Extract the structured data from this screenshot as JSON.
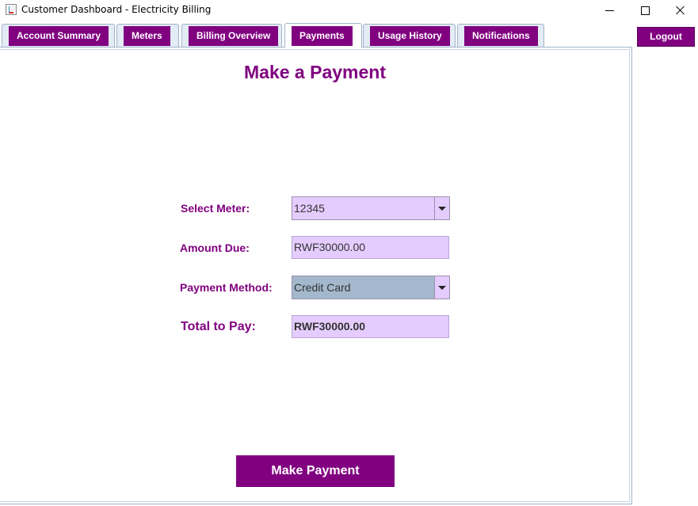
{
  "window": {
    "title": "Customer Dashboard - Electricity Billing"
  },
  "tabs": [
    {
      "label": "Account Summary",
      "selected": false
    },
    {
      "label": "Meters",
      "selected": false
    },
    {
      "label": "Billing Overview",
      "selected": false
    },
    {
      "label": "Payments",
      "selected": true
    },
    {
      "label": "Usage History",
      "selected": false
    },
    {
      "label": "Notifications",
      "selected": false
    }
  ],
  "logout_label": "Logout",
  "payment_form": {
    "heading": "Make a Payment",
    "select_meter_label": "Select Meter:",
    "select_meter_value": "12345",
    "amount_due_label": "Amount Due:",
    "amount_due_value": "RWF30000.00",
    "payment_method_label": "Payment Method:",
    "payment_method_value": "Credit Card",
    "total_label": "Total to Pay:",
    "total_value": "RWF30000.00",
    "submit_label": "Make Payment"
  },
  "colors": {
    "accent": "#800080",
    "field_background": "#e5ccff",
    "selected_option_background": "#a3b8cc"
  }
}
